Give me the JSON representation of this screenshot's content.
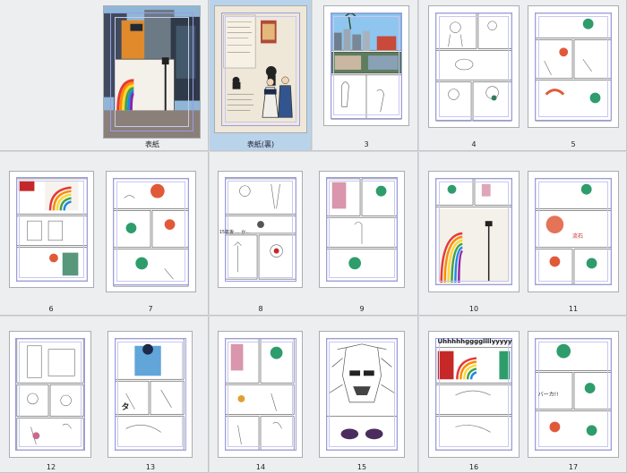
{
  "pages": [
    {
      "label": "表紙",
      "selected": false
    },
    {
      "label": "表紙(裏)",
      "selected": true
    },
    {
      "label": "3",
      "selected": false
    },
    {
      "label": "4",
      "selected": false
    },
    {
      "label": "5",
      "selected": false
    },
    {
      "label": "6",
      "selected": false
    },
    {
      "label": "7",
      "selected": false
    },
    {
      "label": "8",
      "selected": false
    },
    {
      "label": "9",
      "selected": false
    },
    {
      "label": "10",
      "selected": false
    },
    {
      "label": "11",
      "selected": false
    },
    {
      "label": "12",
      "selected": false
    },
    {
      "label": "13",
      "selected": false
    },
    {
      "label": "14",
      "selected": false
    },
    {
      "label": "15",
      "selected": false
    },
    {
      "label": "16",
      "selected": false
    },
    {
      "label": "17",
      "selected": false
    }
  ],
  "page_text": {
    "p8_caption": "15年後 … か…",
    "p11_text": "流石",
    "p13_text": "タ",
    "p16_text": "Uhhhhhggggllllyyyyy",
    "p17_text": "バーカ!!"
  },
  "colors": {
    "background": "#d5d7d9",
    "cell": "#eceef0",
    "selected_cell": "#b9d3ea",
    "guide_line": "#9a9ce6",
    "rainbow": [
      "#e53935",
      "#fb8c00",
      "#fdd835",
      "#43a047",
      "#1e88e5",
      "#8e24aa"
    ]
  }
}
